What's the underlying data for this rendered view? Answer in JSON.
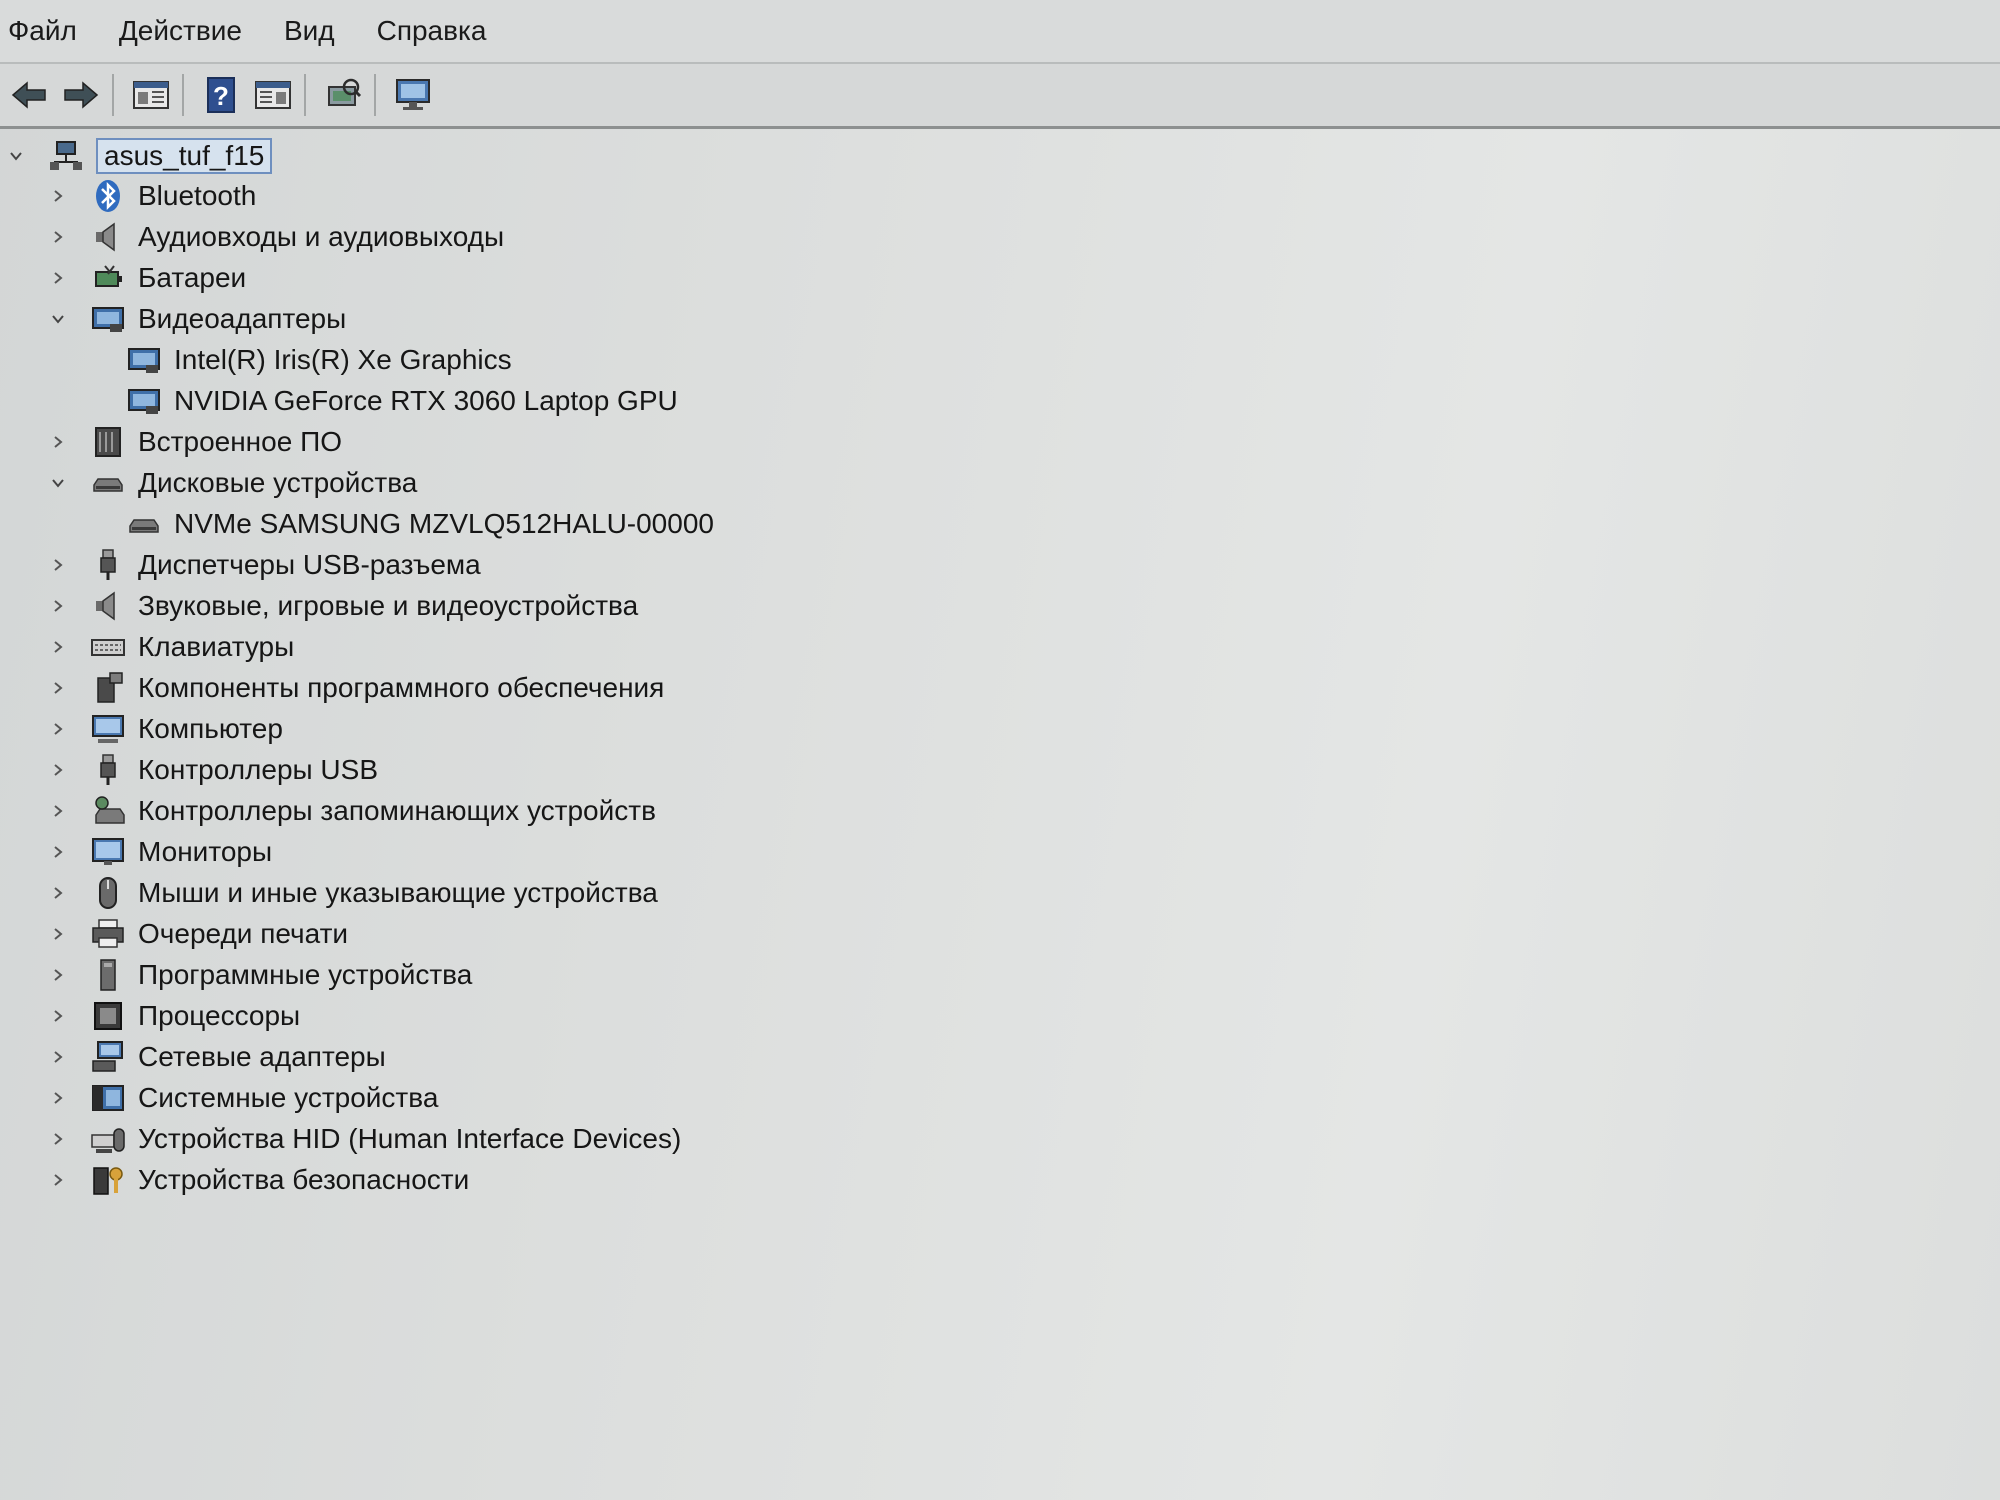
{
  "menu": [
    "Файл",
    "Действие",
    "Вид",
    "Справка"
  ],
  "toolbar": {
    "buttons": [
      "back-arrow-icon",
      "forward-arrow-icon",
      "show-hide-console-tree-icon",
      "help-icon",
      "properties-pane-icon",
      "scan-hardware-icon",
      "monitor-icon"
    ]
  },
  "tree": {
    "root": {
      "label": "asus_tuf_f15",
      "icon": "computer-network-icon"
    },
    "categories": [
      {
        "label": "Bluetooth",
        "icon": "bluetooth-icon",
        "expanded": false
      },
      {
        "label": "Аудиовходы и аудиовыходы",
        "icon": "speaker-icon",
        "expanded": false
      },
      {
        "label": "Батареи",
        "icon": "battery-icon",
        "expanded": false
      },
      {
        "label": "Видеоадаптеры",
        "icon": "display-adapter-icon",
        "expanded": true,
        "children": [
          {
            "label": "Intel(R) Iris(R) Xe Graphics",
            "icon": "display-adapter-icon"
          },
          {
            "label": "NVIDIA GeForce RTX 3060 Laptop GPU",
            "icon": "display-adapter-icon"
          }
        ]
      },
      {
        "label": "Встроенное ПО",
        "icon": "firmware-icon",
        "expanded": false
      },
      {
        "label": "Дисковые устройства",
        "icon": "disk-drive-icon",
        "expanded": true,
        "children": [
          {
            "label": "NVMe SAMSUNG MZVLQ512HALU-00000",
            "icon": "disk-drive-icon"
          }
        ]
      },
      {
        "label": "Диспетчеры USB-разъема",
        "icon": "usb-connector-icon",
        "expanded": false
      },
      {
        "label": "Звуковые, игровые и видеоустройства",
        "icon": "speaker-icon",
        "expanded": false
      },
      {
        "label": "Клавиатуры",
        "icon": "keyboard-icon",
        "expanded": false
      },
      {
        "label": "Компоненты программного обеспечения",
        "icon": "software-component-icon",
        "expanded": false
      },
      {
        "label": "Компьютер",
        "icon": "computer-icon",
        "expanded": false
      },
      {
        "label": "Контроллеры USB",
        "icon": "usb-icon",
        "expanded": false
      },
      {
        "label": "Контроллеры запоминающих устройств",
        "icon": "storage-controller-icon",
        "expanded": false
      },
      {
        "label": "Мониторы",
        "icon": "monitor-icon",
        "expanded": false
      },
      {
        "label": "Мыши и иные указывающие устройства",
        "icon": "mouse-icon",
        "expanded": false
      },
      {
        "label": "Очереди печати",
        "icon": "printer-icon",
        "expanded": false
      },
      {
        "label": "Программные устройства",
        "icon": "software-device-icon",
        "expanded": false
      },
      {
        "label": "Процессоры",
        "icon": "processor-icon",
        "expanded": false
      },
      {
        "label": "Сетевые адаптеры",
        "icon": "network-adapter-icon",
        "expanded": false
      },
      {
        "label": "Системные устройства",
        "icon": "system-device-icon",
        "expanded": false
      },
      {
        "label": "Устройства HID (Human Interface Devices)",
        "icon": "hid-icon",
        "expanded": false
      },
      {
        "label": "Устройства безопасности",
        "icon": "security-device-icon",
        "expanded": false
      }
    ]
  }
}
